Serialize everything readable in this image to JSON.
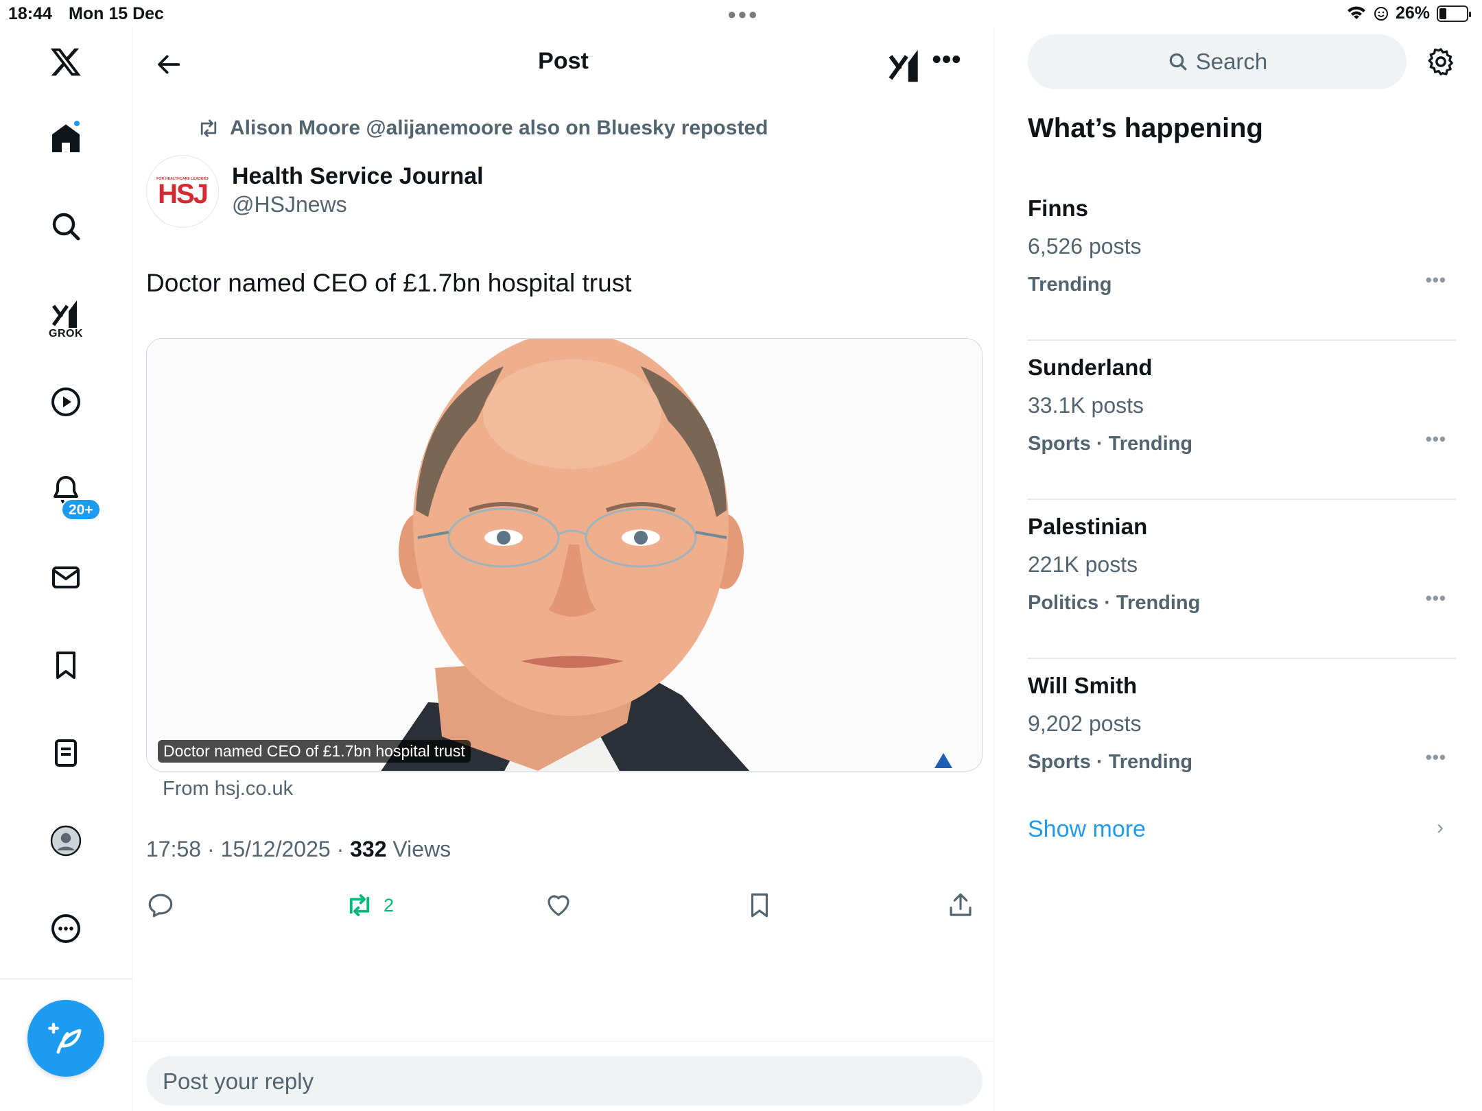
{
  "status_bar": {
    "time": "18:44",
    "date": "Mon 15 Dec",
    "battery": "26%",
    "battery_level": 0.26
  },
  "nav": {
    "items": [
      "home-icon",
      "search-icon",
      "grok-icon",
      "video-icon",
      "notifications-icon",
      "messages-icon",
      "bookmarks-icon",
      "lists-icon",
      "profile-icon",
      "more-icon"
    ],
    "grok_label": "GROK",
    "notifications_badge": "20+",
    "accent": "#1d9bf0"
  },
  "header": {
    "title": "Post"
  },
  "post": {
    "repost_text": "Alison Moore @alijanemoore also on Bluesky reposted",
    "avatar_small_text": "FOR HEALTHCARE LEADERS",
    "avatar_logo": "HSJ",
    "author_name": "Health Service Journal",
    "author_handle": "@HSJnews",
    "text": "Doctor named CEO of £1.7bn hospital trust",
    "media_caption": "Doctor named CEO of £1.7bn hospital trust",
    "from_link": "From hsj.co.uk",
    "timestamp": "17:58 · 15/12/2025 · ",
    "views_count": "332",
    "views_label": " Views",
    "retweet_count": "2",
    "retweet_color": "#00ba7c"
  },
  "reply": {
    "placeholder": "Post your reply"
  },
  "sidebar": {
    "search_placeholder": "Search",
    "section_title": "What’s happening",
    "trends": [
      {
        "name": "Finns",
        "count": "6,526 posts",
        "category": "Trending"
      },
      {
        "name": "Sunderland",
        "count": "33.1K posts",
        "category": "Sports · Trending"
      },
      {
        "name": "Palestinian",
        "count": "221K posts",
        "category": "Politics · Trending"
      },
      {
        "name": "Will Smith",
        "count": "9,202 posts",
        "category": "Sports · Trending"
      }
    ],
    "show_more": "Show more"
  }
}
